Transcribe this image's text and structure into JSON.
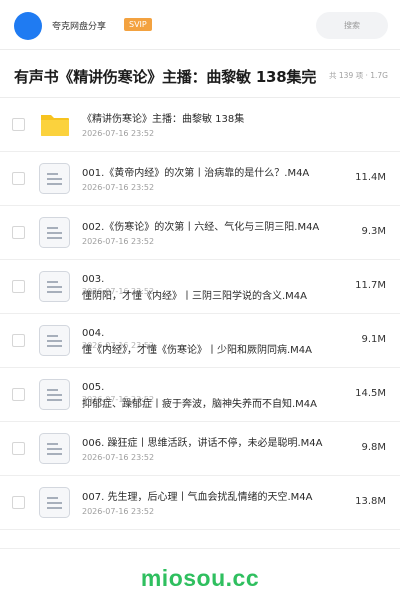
{
  "header": {
    "brand": "夸克网盘分享",
    "vip_badge": "SVIP",
    "search_placeholder": "搜索",
    "colors": {
      "avatar": "#1f7bf2",
      "vip": "#f3a240"
    }
  },
  "title_bar": {
    "title": "有声书《精讲伤寒论》主播：曲黎敏 138集完",
    "meta": "共 139 项 · 1.7G"
  },
  "files": [
    {
      "type": "folder-icon",
      "name": "《精讲伤寒论》主播：曲黎敏 138集",
      "date": "2026-07-16 23:52",
      "size": ""
    },
    {
      "type": "document-icon",
      "name": "001.《黄帝内经》的次第丨治病靠的是什么？.M4A",
      "date": "2026-07-16 23:52",
      "size": "11.4M"
    },
    {
      "type": "document-icon",
      "name": "002.《伤寒论》的次第丨六经、气化与三阴三阳.M4A",
      "date": "2026-07-16 23:52",
      "size": "9.3M"
    },
    {
      "type": "document-icon",
      "name_a": "003.",
      "name_b": "懂阴阳，才懂《内经》丨三阴三阳学说的含义.M4A",
      "date": "2026-07-16 23:52",
      "size": "11.7M"
    },
    {
      "type": "document-icon",
      "name_a": "004.",
      "name_b": "懂《内经》，才懂《伤寒论》丨少阳和厥阴同病.M4A",
      "date": "2026-07-16 23:52",
      "size": "9.1M"
    },
    {
      "type": "document-icon",
      "name_a": "005.",
      "name_b": "抑郁症、躁郁症丨疲于奔波，脑神失养而不自知.M4A",
      "date": "2026-07-16 23:52",
      "size": "14.5M"
    },
    {
      "type": "document-icon",
      "name": "006. 躁狂症丨思维活跃，讲话不停，未必是聪明.M4A",
      "date": "2026-07-16 23:52",
      "size": "9.8M"
    },
    {
      "type": "document-icon",
      "name": "007. 先生理，后心理丨气血会扰乱情绪的天空.M4A",
      "date": "2026-07-16 23:52",
      "size": "13.8M"
    }
  ],
  "footer": {
    "watermark": "miosou.cc",
    "color": "#2fbf5f"
  }
}
